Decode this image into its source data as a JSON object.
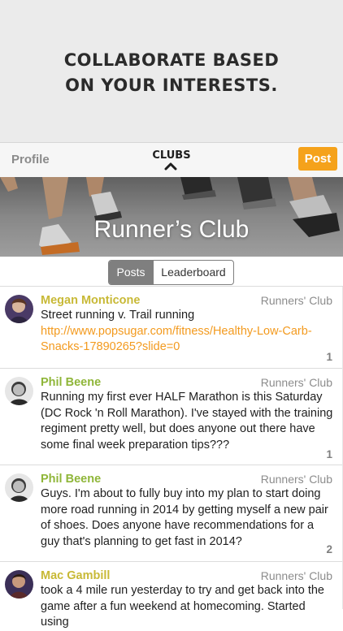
{
  "banner": {
    "line1": "COLLABORATE BASED",
    "line2": "ON YOUR INTERESTS."
  },
  "nav": {
    "profile_label": "Profile",
    "title": "CLUBS",
    "post_label": "Post"
  },
  "hero": {
    "title": "Runner’s Club"
  },
  "segments": [
    {
      "label": "Posts",
      "selected": true
    },
    {
      "label": "Leaderboard",
      "selected": false
    }
  ],
  "colors": {
    "accent": "#f5a21b",
    "author_yellow": "#c8b936",
    "author_green": "#8fb639"
  },
  "posts": [
    {
      "author": "Megan Monticone",
      "club": "Runners' Club",
      "text": "Street running v. Trail running",
      "link": "http://www.popsugar.com/fitness/Healthy-Low-Carb-Snacks-17890265?slide=0",
      "count": "1"
    },
    {
      "author": "Phil Beene",
      "club": "Runners' Club",
      "text": "Running my first ever HALF Marathon is this Saturday (DC Rock 'n Roll Marathon). I've stayed with the training regiment pretty well, but does anyone out there have some final week preparation tips???",
      "count": "1"
    },
    {
      "author": "Phil Beene",
      "club": "Runners' Club",
      "text": "Guys. I'm about to fully buy into my plan to start doing more road running in 2014 by getting myself a new pair of shoes. Does anyone have recommendations for a guy that's planning to get fast in 2014?",
      "count": "2"
    },
    {
      "author": "Mac Gambill",
      "club": "Runners' Club",
      "text": "took a 4 mile run yesterday to try and get back into the game after a fun weekend at homecoming. Started using"
    }
  ]
}
